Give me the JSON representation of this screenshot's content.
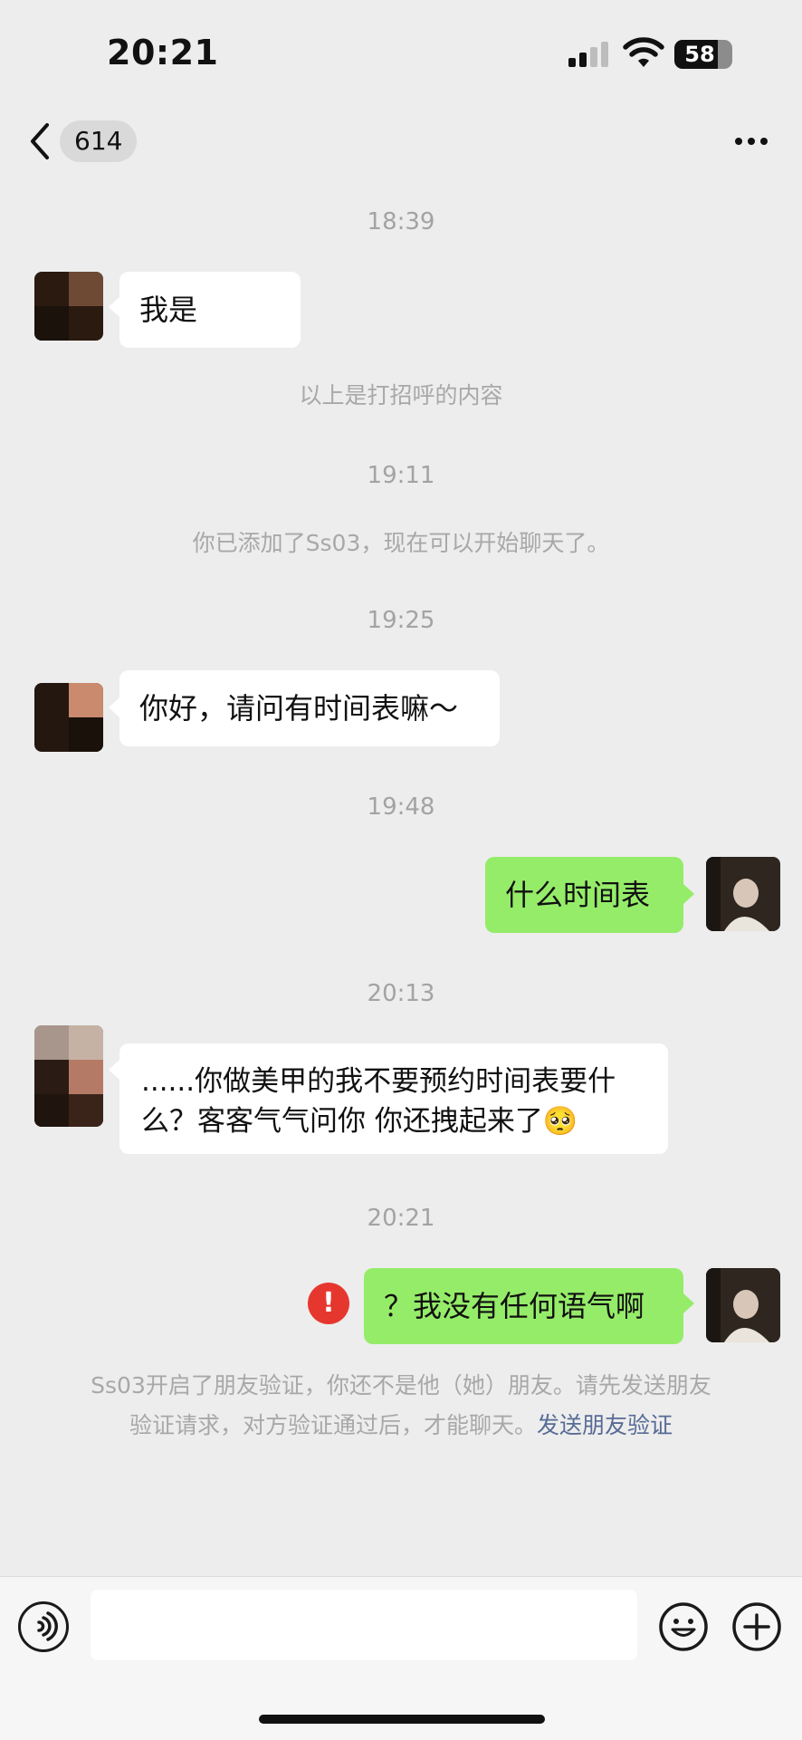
{
  "status_bar": {
    "time": "20:21",
    "battery": "58"
  },
  "nav": {
    "count": "614"
  },
  "chat": {
    "time_1": "18:39",
    "msg_1": "我是",
    "greeting_note": "以上是打招呼的内容",
    "time_2": "19:11",
    "added_note": "你已添加了Ss03，现在可以开始聊天了。",
    "time_3": "19:25",
    "msg_2": "你好，请问有时间表嘛～",
    "time_4": "19:48",
    "msg_3": "什么时间表",
    "time_5": "20:13",
    "msg_4_line1": "......你做美甲的我不要预约时间表要什",
    "msg_4_line2": "么？客客气气问你 你还拽起来了",
    "msg_4_emoji": "🥺",
    "time_6": "20:21",
    "msg_5": "？我没有任何语气啊",
    "error_mark": "!",
    "verify_notice_line1": "Ss03开启了朋友验证，你还不是他（她）朋友。请先发送朋友",
    "verify_notice_line2": "验证请求，对方验证通过后，才能聊天。",
    "verify_link": "发送朋友验证"
  },
  "input": {
    "placeholder": ""
  },
  "icons": {
    "back": "chevron-left-icon",
    "more": "more-dots-icon",
    "voice": "voice-icon",
    "emoji": "emoji-icon",
    "plus": "plus-icon",
    "error": "error-icon"
  },
  "colors": {
    "background": "#ededed",
    "bubble_me": "#95ec69",
    "bubble_other": "#ffffff",
    "link": "#576b95",
    "error": "#e6372f"
  }
}
